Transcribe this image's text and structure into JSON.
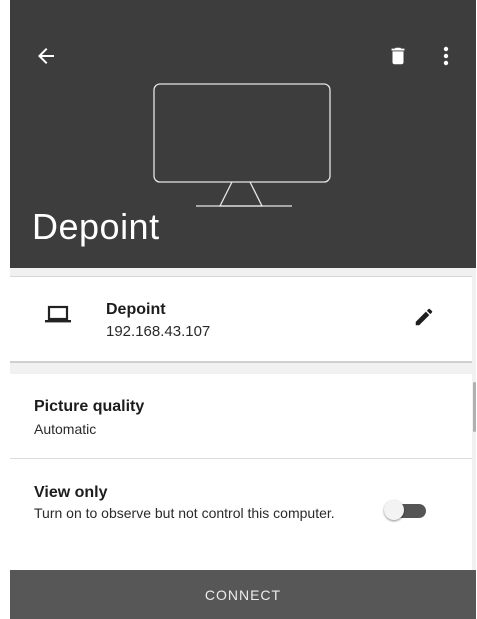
{
  "header": {
    "title": "Depoint",
    "back_icon": "arrow-left-icon",
    "delete_icon": "trash-icon",
    "more_icon": "more-vert-icon",
    "device_illustration": "monitor-icon"
  },
  "device": {
    "name": "Depoint",
    "ip": "192.168.43.107",
    "icon": "laptop-icon",
    "edit_icon": "pencil-icon"
  },
  "settings": {
    "picture_quality": {
      "title": "Picture quality",
      "value": "Automatic"
    },
    "view_only": {
      "title": "View only",
      "description": "Turn on to observe but not control this computer.",
      "enabled": false
    }
  },
  "footer": {
    "connect_label": "CONNECT"
  },
  "colors": {
    "header_bg": "#3d3d3d",
    "footer_bg": "#575757",
    "card_bg": "#ffffff"
  }
}
